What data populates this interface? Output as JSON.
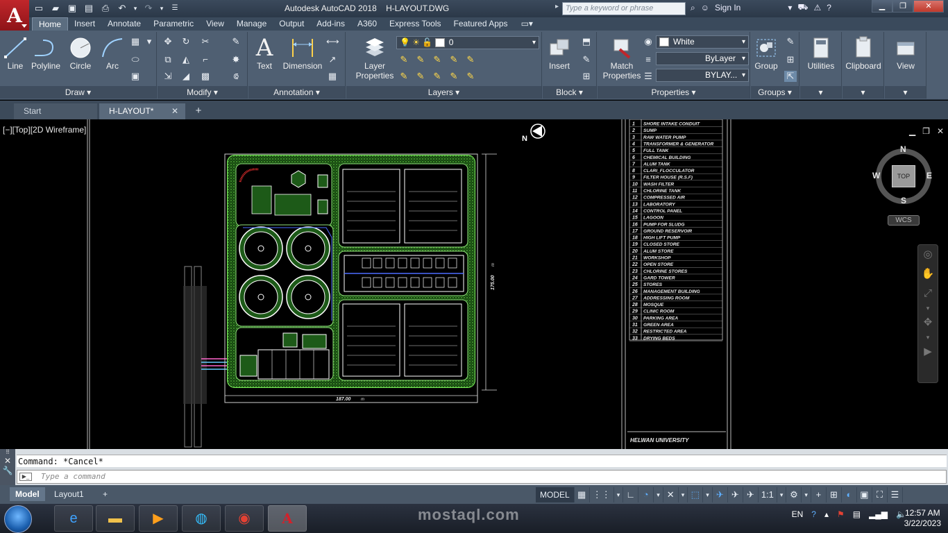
{
  "app": {
    "logo": "A",
    "title": "Autodesk AutoCAD 2018",
    "filename": "H-LAYOUT.DWG",
    "search_placeholder": "Type a keyword or phrase",
    "sign_in": "Sign In"
  },
  "ribbon_tabs": [
    "Home",
    "Insert",
    "Annotate",
    "Parametric",
    "View",
    "Manage",
    "Output",
    "Add-ins",
    "A360",
    "Express Tools",
    "Featured Apps"
  ],
  "panels": {
    "draw": {
      "title": "Draw",
      "tools": [
        "Line",
        "Polyline",
        "Circle",
        "Arc"
      ]
    },
    "modify": {
      "title": "Modify"
    },
    "annotation": {
      "title": "Annotation",
      "tools": [
        "Text",
        "Dimension"
      ]
    },
    "layers": {
      "title": "Layers",
      "tool": "Layer\nProperties",
      "layer_value": "0"
    },
    "block": {
      "title": "Block",
      "tool": "Insert"
    },
    "properties": {
      "title": "Properties",
      "tool": "Match\nProperties",
      "color": "White",
      "linetype": "ByLayer",
      "lineweight": "BYLAY..."
    },
    "groups": {
      "title": "Groups",
      "tool": "Group"
    },
    "utilities": {
      "tool": "Utilities"
    },
    "clipboard": {
      "tool": "Clipboard"
    },
    "view": {
      "tool": "View"
    }
  },
  "file_tabs": {
    "start": "Start",
    "active": "H-LAYOUT*",
    "close": "✕",
    "add": "+"
  },
  "viewport": {
    "label": "[−][Top][2D Wireframe]",
    "north": "N",
    "viewcube": {
      "top": "TOP",
      "n": "N",
      "s": "S",
      "e": "E",
      "w": "W",
      "wcs": "WCS"
    },
    "dim_width": "187.00",
    "dim_width_unit": "m",
    "dim_height": "175.00",
    "dim_height_unit": "m"
  },
  "legend": [
    {
      "n": "1",
      "t": "SHORE INTAKE CONDUIT"
    },
    {
      "n": "2",
      "t": "SUMP"
    },
    {
      "n": "3",
      "t": "RAW WATER PUMP"
    },
    {
      "n": "4",
      "t": "TRANSFORMER & GENERATOR"
    },
    {
      "n": "5",
      "t": "FULL TANK"
    },
    {
      "n": "6",
      "t": "CHEMICAL BUILDING"
    },
    {
      "n": "7",
      "t": "ALUM TANK"
    },
    {
      "n": "8",
      "t": "CLARI_FLOCCULATOR"
    },
    {
      "n": "9",
      "t": "FILTER HOUSE (R.S.F)"
    },
    {
      "n": "10",
      "t": "WASH FILTER"
    },
    {
      "n": "11",
      "t": "CHLORINE TANK"
    },
    {
      "n": "12",
      "t": "COMPRESSED AIR"
    },
    {
      "n": "13",
      "t": "LABORATORY"
    },
    {
      "n": "14",
      "t": "CONTROL PANEL"
    },
    {
      "n": "15",
      "t": "LAGOON"
    },
    {
      "n": "16",
      "t": "PUMP FOR SLUDG"
    },
    {
      "n": "17",
      "t": "GROUND RESERVOIR"
    },
    {
      "n": "18",
      "t": "HIGH LIFT PUMP"
    },
    {
      "n": "19",
      "t": "CLOSED STORE"
    },
    {
      "n": "20",
      "t": "ALUM STORE"
    },
    {
      "n": "21",
      "t": "WORKSHOP"
    },
    {
      "n": "22",
      "t": "OPEN STORE"
    },
    {
      "n": "23",
      "t": "CHLORINE STORES"
    },
    {
      "n": "24",
      "t": "GARD TOWER"
    },
    {
      "n": "25",
      "t": "STORES"
    },
    {
      "n": "26",
      "t": "MANAGEMENT BUILDING"
    },
    {
      "n": "27",
      "t": "ADDRESSING ROOM"
    },
    {
      "n": "28",
      "t": "MOSQUE"
    },
    {
      "n": "29",
      "t": "CLINIC ROOM"
    },
    {
      "n": "30",
      "t": "PARKING AREA"
    },
    {
      "n": "31",
      "t": "GREEN AREA"
    },
    {
      "n": "32",
      "t": "RESTRICTED AREA"
    },
    {
      "n": "33",
      "t": "DRYING BEDS"
    }
  ],
  "title_block": {
    "university": "HELWAN UNIVERSITY"
  },
  "command": {
    "history": "Command: *Cancel*",
    "placeholder": "Type a command",
    "prompt": "▶_"
  },
  "status": {
    "model_tab": "Model",
    "layout_tab": "Layout1",
    "add_tab": "+",
    "model_button": "MODEL",
    "scale": "1:1"
  },
  "taskbar": {
    "lang": "EN",
    "time": "12:57 AM",
    "date": "3/22/2023"
  },
  "watermark": {
    "text": "mostaql.com"
  },
  "colors": {
    "accent": "#c0262b",
    "ribbon": "#4f5f72",
    "site_green": "#2f8f2a",
    "site_line": "#9cff6a"
  }
}
